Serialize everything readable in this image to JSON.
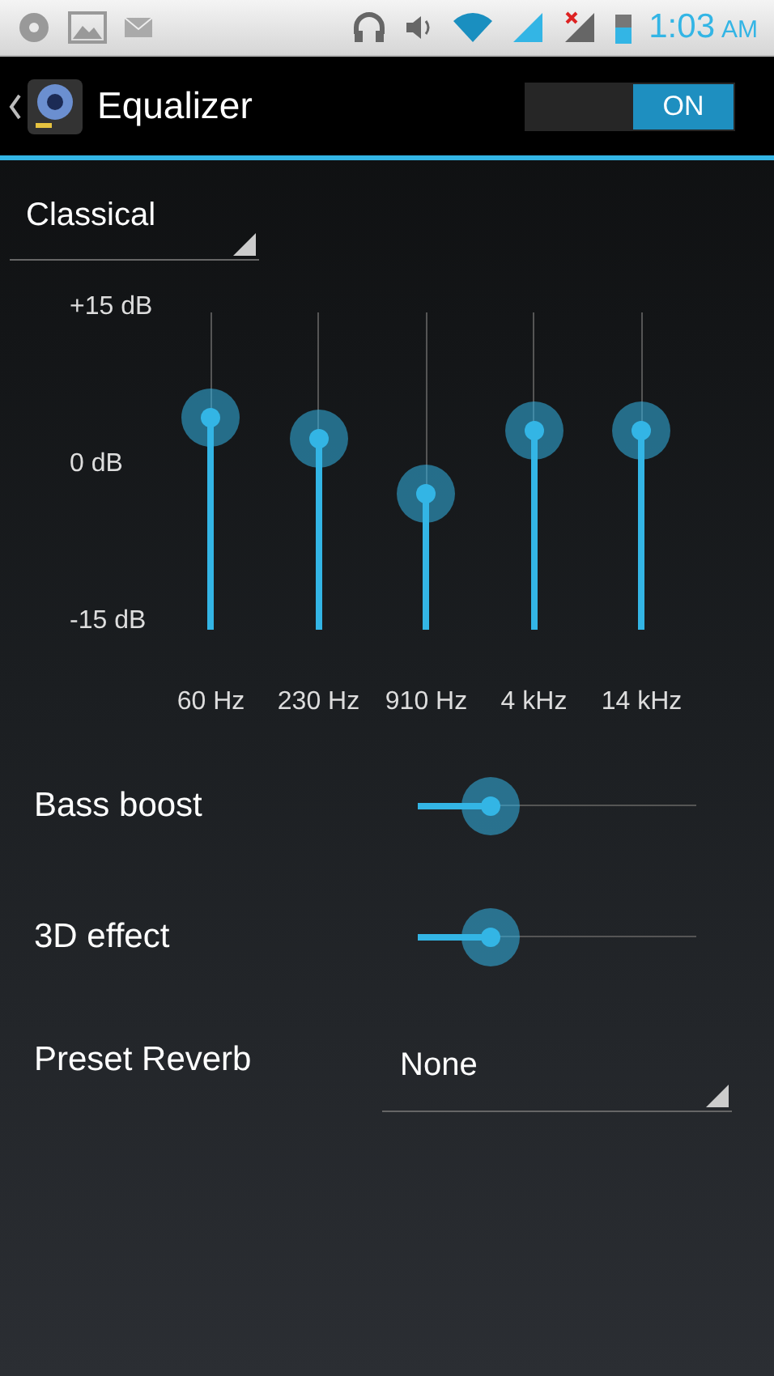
{
  "status_bar": {
    "time": "1:03",
    "period": "AM"
  },
  "action_bar": {
    "title": "Equalizer",
    "switch": {
      "label": "ON",
      "on": true
    }
  },
  "preset": {
    "value": "Classical"
  },
  "equalizer": {
    "scale_labels": [
      "+15 dB",
      "0 dB",
      "-15 dB"
    ],
    "bands": [
      {
        "label": "60 Hz",
        "level": 0.67
      },
      {
        "label": "230 Hz",
        "level": 0.6
      },
      {
        "label": "910 Hz",
        "level": 0.43
      },
      {
        "label": "4 kHz",
        "level": 0.63
      },
      {
        "label": "14 kHz",
        "level": 0.63
      }
    ]
  },
  "effects": [
    {
      "label": "Bass boost",
      "level": 0.26
    },
    {
      "label": "3D effect",
      "level": 0.26
    }
  ],
  "reverb": {
    "label": "Preset Reverb",
    "value": "None"
  }
}
